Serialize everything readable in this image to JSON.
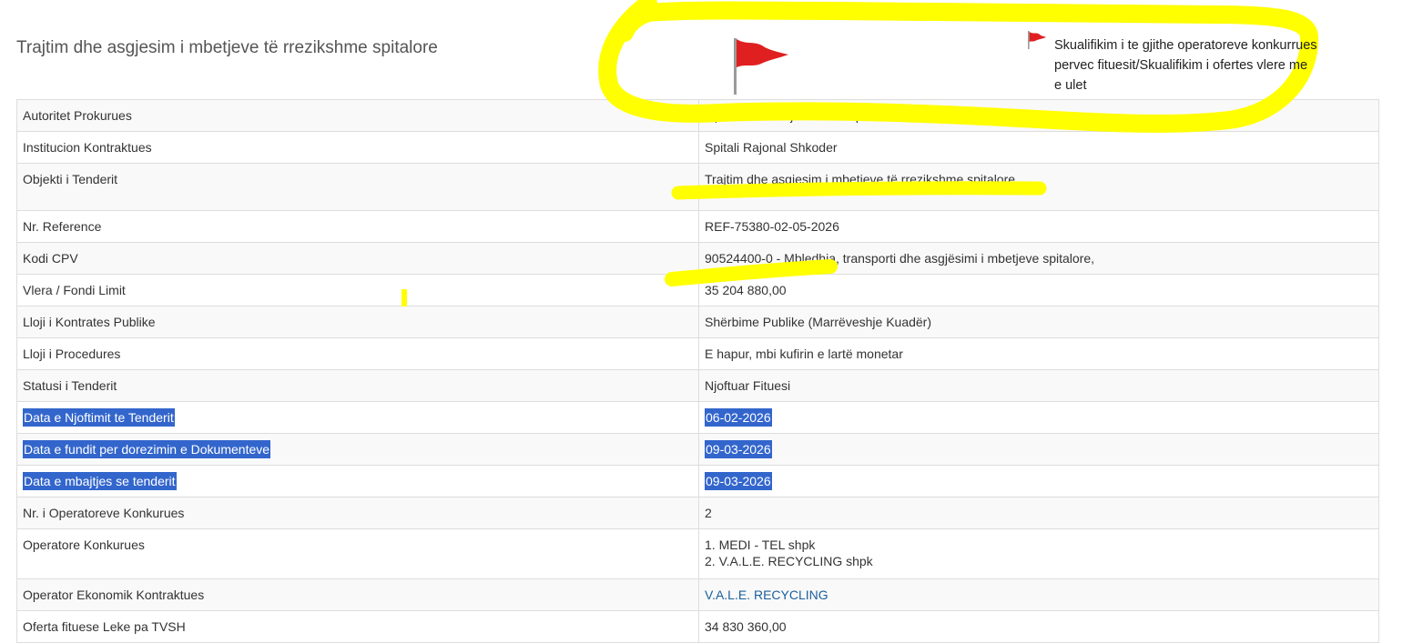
{
  "page": {
    "title": "Trajtim dhe asgjesim i mbetjeve të rrezikshme spitalore"
  },
  "annotation": {
    "note": "Skualifikim i te gjithe operatoreve konkurrues pervec fituesit/Skualifikim i ofertes vlere me e ulet",
    "highlight_color": "#ffff00",
    "flag_color": "#e02020"
  },
  "colors": {
    "selection": "#3366cc",
    "link": "#1a5f9c"
  },
  "rows": [
    {
      "label": "Autoritet Prokurues",
      "value": "Operatori i Blerjeve të Përqendruara"
    },
    {
      "label": "Institucion Kontraktues",
      "value": "Spitali Rajonal Shkoder"
    },
    {
      "label": "Objekti i Tenderit",
      "value": "Trajtim dhe asgjesim i mbetjeve të rrezikshme spitalore"
    },
    {
      "label": "Nr. Reference",
      "value": "REF-75380-02-05-2026"
    },
    {
      "label": "Kodi CPV",
      "value": "90524400-0 - Mbledhja, transporti dhe asgjësimi i mbetjeve spitalore,"
    },
    {
      "label": "Vlera / Fondi Limit",
      "value": "35 204 880,00"
    },
    {
      "label": "Lloji i Kontrates Publike",
      "value": "Shërbime Publike (Marrëveshje Kuadër)"
    },
    {
      "label": "Lloji i Procedures",
      "value": "E hapur, mbi kufirin e lartë monetar"
    },
    {
      "label": "Statusi i Tenderit",
      "value": "Njoftuar Fituesi"
    },
    {
      "label": "Data e Njoftimit te Tenderit",
      "value": "06-02-2026"
    },
    {
      "label": "Data e fundit per dorezimin e Dokumenteve",
      "value": "09-03-2026"
    },
    {
      "label": "Data e mbajtjes se tenderit",
      "value": "09-03-2026"
    },
    {
      "label": "Nr. i Operatoreve Konkurues",
      "value": "2"
    },
    {
      "label": "Operatore Konkurues",
      "values": [
        "1. MEDI - TEL shpk",
        "2. V.A.L.E. RECYCLING shpk"
      ]
    },
    {
      "label": "Operator Ekonomik Kontraktues",
      "value": "V.A.L.E. RECYCLING"
    },
    {
      "label": "Oferta fituese Leke pa TVSH",
      "value": "34 830 360,00"
    }
  ]
}
